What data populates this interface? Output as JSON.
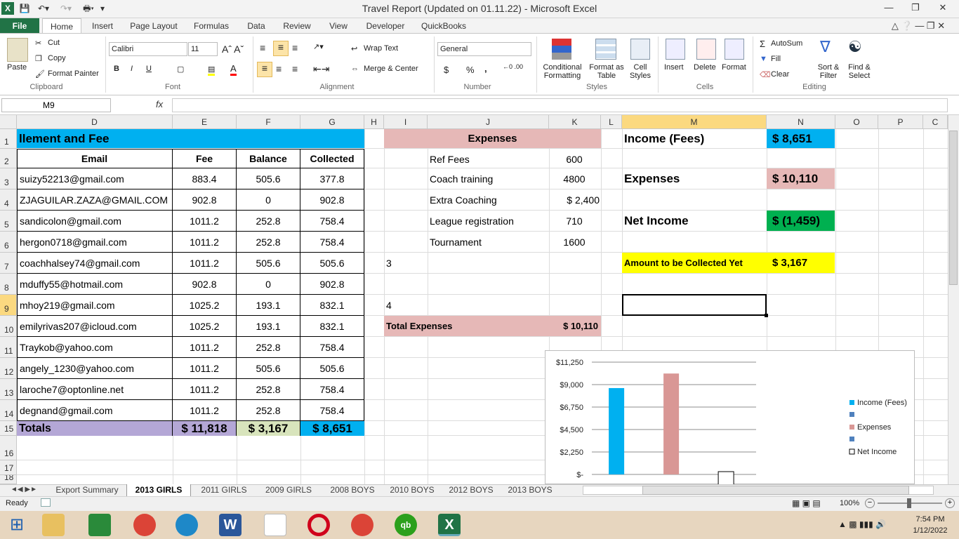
{
  "window": {
    "title": "Travel Report (Updated on 01.11.22)  -  Microsoft Excel"
  },
  "ribbon_tabs": [
    "File",
    "Home",
    "Insert",
    "Page Layout",
    "Formulas",
    "Data",
    "Review",
    "View",
    "Developer",
    "QuickBooks"
  ],
  "ribbon": {
    "clipboard": {
      "paste": "Paste",
      "cut": "Cut",
      "copy": "Copy",
      "format_painter": "Format Painter",
      "label": "Clipboard"
    },
    "font": {
      "name": "Calibri",
      "size": "11",
      "label": "Font"
    },
    "alignment": {
      "wrap": "Wrap Text",
      "merge": "Merge & Center",
      "label": "Alignment"
    },
    "number": {
      "format": "General",
      "currency": "$",
      "percent": "%",
      "comma": ",",
      "label": "Number"
    },
    "styles": {
      "conditional": "Conditional Formatting",
      "table": "Format as Table",
      "cell": "Cell Styles",
      "label": "Styles"
    },
    "cells": {
      "insert": "Insert",
      "delete": "Delete",
      "format": "Format",
      "label": "Cells"
    },
    "editing": {
      "autosum": "AutoSum",
      "fill": "Fill",
      "clear": "Clear",
      "sort": "Sort & Filter",
      "find": "Find & Select",
      "label": "Editing"
    }
  },
  "formula_bar": {
    "name_box": "M9",
    "fx": "fx",
    "formula": ""
  },
  "columns": [
    "D",
    "E",
    "F",
    "G",
    "H",
    "I",
    "J",
    "K",
    "L",
    "M",
    "N",
    "O",
    "P",
    "C"
  ],
  "rows": [
    "1",
    "2",
    "3",
    "4",
    "5",
    "6",
    "7",
    "8",
    "9",
    "10",
    "11",
    "12",
    "13",
    "14",
    "15",
    "16",
    "17",
    "18"
  ],
  "table": {
    "title": "llement and Fee",
    "headers": {
      "email": "Email",
      "fee": "Fee",
      "balance": "Balance",
      "collected": "Collected"
    },
    "records": [
      {
        "email": "suizy52213@gmail.com",
        "fee": "883.4",
        "balance": "505.6",
        "collected": "377.8"
      },
      {
        "email": "ZJAGUILAR.ZAZA@GMAIL.COM",
        "fee": "902.8",
        "balance": "0",
        "collected": "902.8"
      },
      {
        "email": "sandicolon@gmail.com",
        "fee": "1011.2",
        "balance": "252.8",
        "collected": "758.4"
      },
      {
        "email": "hergon0718@gmail.com",
        "fee": "1011.2",
        "balance": "252.8",
        "collected": "758.4"
      },
      {
        "email": "coachhalsey74@gmail.com",
        "fee": "1011.2",
        "balance": "505.6",
        "collected": "505.6"
      },
      {
        "email": "mduffy55@hotmail.com",
        "fee": "902.8",
        "balance": "0",
        "collected": "902.8"
      },
      {
        "email": "mhoy219@gmail.com",
        "fee": "1025.2",
        "balance": "193.1",
        "collected": "832.1"
      },
      {
        "email": "emilyrivas207@icloud.com",
        "fee": "1025.2",
        "balance": "193.1",
        "collected": "832.1"
      },
      {
        "email": "Traykob@yahoo.com",
        "fee": "1011.2",
        "balance": "252.8",
        "collected": "758.4"
      },
      {
        "email": "angely_1230@yahoo.com",
        "fee": "1011.2",
        "balance": "505.6",
        "collected": "505.6"
      },
      {
        "email": "laroche7@optonline.net",
        "fee": "1011.2",
        "balance": "252.8",
        "collected": "758.4"
      },
      {
        "email": "degnand@gmail.com",
        "fee": "1011.2",
        "balance": "252.8",
        "collected": "758.4"
      }
    ],
    "totals": {
      "label": "Totals",
      "fee": "$  11,818",
      "balance": "$    3,167",
      "collected": "$   8,651"
    }
  },
  "expenses": {
    "title": "Expenses",
    "items": [
      {
        "name": "Ref Fees",
        "amount": "600"
      },
      {
        "name": "Coach training",
        "amount": "4800"
      },
      {
        "name": "Extra Coaching",
        "amount": "$    2,400"
      },
      {
        "name": "League registration",
        "amount": "710"
      },
      {
        "name": "Tournament",
        "amount": "1600"
      }
    ],
    "i7": "3",
    "i9": "4",
    "total_label": "Total Expenses",
    "total_value": "$  10,110"
  },
  "summary": {
    "income_label": "Income (Fees)",
    "income_value": "$    8,651",
    "expenses_label": "Expenses",
    "expenses_value": "$  10,110",
    "net_label": "Net Income",
    "net_value": "$  (1,459)",
    "collect_label": "Amount to be Collected Yet",
    "collect_value": "$     3,167"
  },
  "chart_data": {
    "type": "bar",
    "categories": [
      "Income (Fees)",
      "Expenses",
      "Net Income"
    ],
    "values": [
      8651,
      10110,
      -1459
    ],
    "ylim": [
      0,
      11250
    ],
    "yticks": [
      "$11,250",
      "$9,000",
      "$6,750",
      "$4,500",
      "$2,250",
      "$-"
    ],
    "legend": [
      "Income (Fees)",
      "",
      "Expenses",
      "",
      "Net Income"
    ],
    "legend_position": "right",
    "colors": [
      "#00b0f0",
      "#d99795",
      "#ffffff"
    ]
  },
  "sheet_tabs": [
    "Export Summary",
    "2013 GIRLS",
    "2011 GIRLS",
    "2009 GIRLS",
    "2008 BOYS",
    "2010 BOYS",
    "2012 BOYS",
    "2013 BOYS"
  ],
  "status": {
    "ready": "Ready",
    "zoom": "100%"
  },
  "taskbar": {
    "time": "7:54 PM",
    "date": "1/12/2022"
  }
}
